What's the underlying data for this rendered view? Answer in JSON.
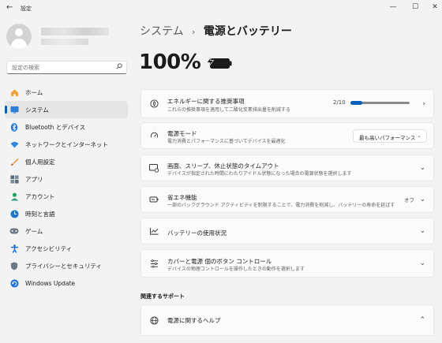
{
  "window": {
    "title": "設定",
    "back": "←",
    "minimize": "—",
    "maximize": "☐",
    "close": "✕"
  },
  "search": {
    "placeholder": "設定の検索",
    "icon": "search-icon"
  },
  "sidebar": {
    "items": [
      {
        "label": "ホーム",
        "icon": "home-icon",
        "active": false
      },
      {
        "label": "システム",
        "icon": "system-icon",
        "active": true
      },
      {
        "label": "Bluetooth とデバイス",
        "icon": "bluetooth-icon",
        "active": false
      },
      {
        "label": "ネットワークとインターネット",
        "icon": "network-icon",
        "active": false
      },
      {
        "label": "個人用設定",
        "icon": "brush-icon",
        "active": false
      },
      {
        "label": "アプリ",
        "icon": "apps-icon",
        "active": false
      },
      {
        "label": "アカウント",
        "icon": "account-icon",
        "active": false
      },
      {
        "label": "時刻と言語",
        "icon": "time-language-icon",
        "active": false
      },
      {
        "label": "ゲーム",
        "icon": "gaming-icon",
        "active": false
      },
      {
        "label": "アクセシビリティ",
        "icon": "accessibility-icon",
        "active": false
      },
      {
        "label": "プライバシーとセキュリティ",
        "icon": "shield-icon",
        "active": false
      },
      {
        "label": "Windows Update",
        "icon": "update-icon",
        "active": false
      }
    ]
  },
  "header": {
    "parent": "システム",
    "separator": "›",
    "current": "電源とバッテリー"
  },
  "battery": {
    "percent": "100%",
    "level": 1.0
  },
  "cards": {
    "recommendations": {
      "title": "エネルギーに関する推奨事項",
      "desc": "これらの推奨事項を適用して二酸化炭素排出量を削減する",
      "progress_text": "2/10",
      "progress": 0.2
    },
    "power_mode": {
      "title": "電源モード",
      "desc": "電力消費とパフォーマンスに基づいてデバイスを最適化",
      "value": "最も高いパフォーマンス"
    },
    "screen_sleep": {
      "title": "画面、スリープ、休止状態のタイムアウト",
      "desc": "デバイスが指定された時間にわたりアイドル状態になった場合の電源状態を選択します"
    },
    "energy_saver": {
      "title": "省エネ機能",
      "desc": "一部のバックグラウンド アクティビティを制限することで、電力消費を削減し、バッテリーの寿命を延ばす",
      "value": "オフ"
    },
    "battery_usage": {
      "title": "バッテリーの使用状況"
    },
    "lid_buttons": {
      "title": "カバーと電源 個のボタン コントロール",
      "desc": "デバイスの物理コントロールを操作したときの動作を選択します"
    }
  },
  "related": {
    "section_title": "関連するサポート",
    "help_title": "電源に関するヘルプ"
  },
  "colors": {
    "accent": "#005fb8",
    "background": "#f3f3f3",
    "card": "#fbfbfb"
  }
}
